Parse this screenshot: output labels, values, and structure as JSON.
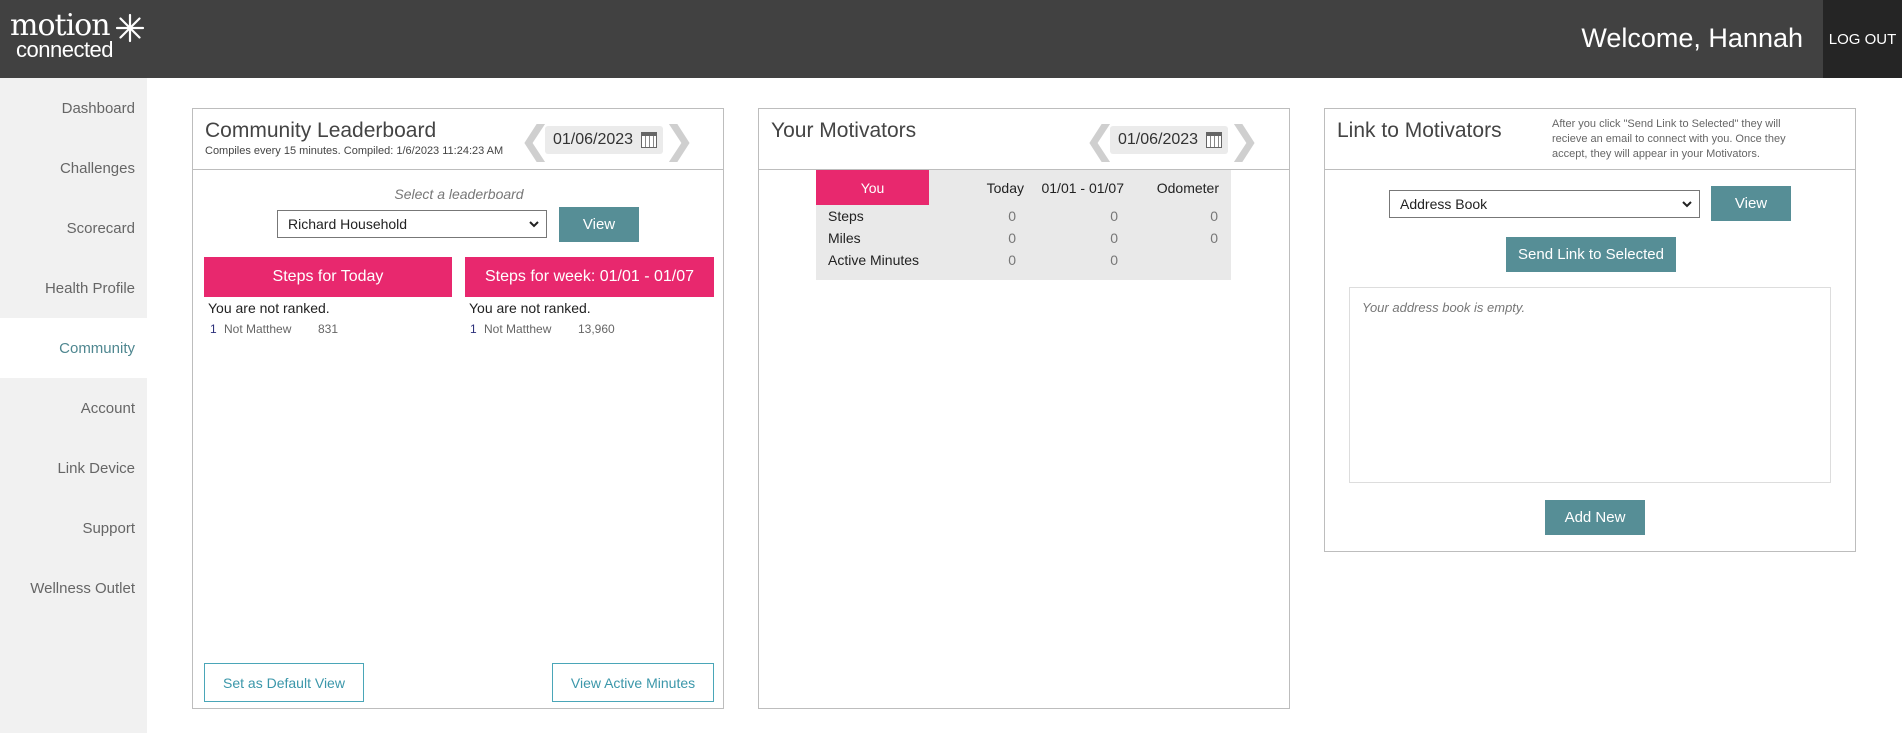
{
  "header": {
    "logo_top": "motion",
    "logo_bottom": "connected",
    "welcome": "Welcome, Hannah",
    "logout": "LOG OUT"
  },
  "sidebar": {
    "items": [
      {
        "label": "Dashboard"
      },
      {
        "label": "Challenges"
      },
      {
        "label": "Scorecard"
      },
      {
        "label": "Health Profile"
      },
      {
        "label": "Community"
      },
      {
        "label": "Account"
      },
      {
        "label": "Link Device"
      },
      {
        "label": "Support"
      },
      {
        "label": "Wellness Outlet"
      }
    ],
    "active": "Community"
  },
  "leaderboard": {
    "title": "Community Leaderboard",
    "subtitle": "Compiles every 15 minutes. Compiled: 1/6/2023 11:24:23 AM",
    "date": "01/06/2023",
    "select_prompt": "Select a leaderboard",
    "selected": "Richard Household",
    "view_label": "View",
    "today": {
      "heading": "Steps for Today",
      "note": "You are not ranked.",
      "rank": "1",
      "name": "Not Matthew",
      "value": "831"
    },
    "week": {
      "heading": "Steps for week: 01/01 - 01/07",
      "note": "You are not ranked.",
      "rank": "1",
      "name": "Not Matthew",
      "value": "13,960"
    },
    "default_view_label": "Set as Default View",
    "active_minutes_label": "View Active Minutes"
  },
  "motivators": {
    "title": "Your Motivators",
    "date": "01/06/2023",
    "columns": {
      "you": "You",
      "today": "Today",
      "week": "01/01 - 01/07",
      "odometer": "Odometer"
    },
    "rows": [
      {
        "label": "Steps",
        "today": "0",
        "week": "0",
        "odometer": "0"
      },
      {
        "label": "Miles",
        "today": "0",
        "week": "0",
        "odometer": "0"
      },
      {
        "label": "Active Minutes",
        "today": "0",
        "week": "0",
        "odometer": ""
      }
    ]
  },
  "link": {
    "title": "Link to Motivators",
    "help": "After you click \"Send Link to Selected\" they will recieve an email to connect with you. Once they accept, they will appear in your Motivators.",
    "selected": "Address Book",
    "view_label": "View",
    "send_label": "Send Link to Selected",
    "empty_text": "Your address book is empty.",
    "add_label": "Add New"
  },
  "colors": {
    "header_bg": "#414141",
    "accent_pink": "#e8286e",
    "accent_teal": "#568e96",
    "sidebar_bg": "#f1f1f1"
  }
}
